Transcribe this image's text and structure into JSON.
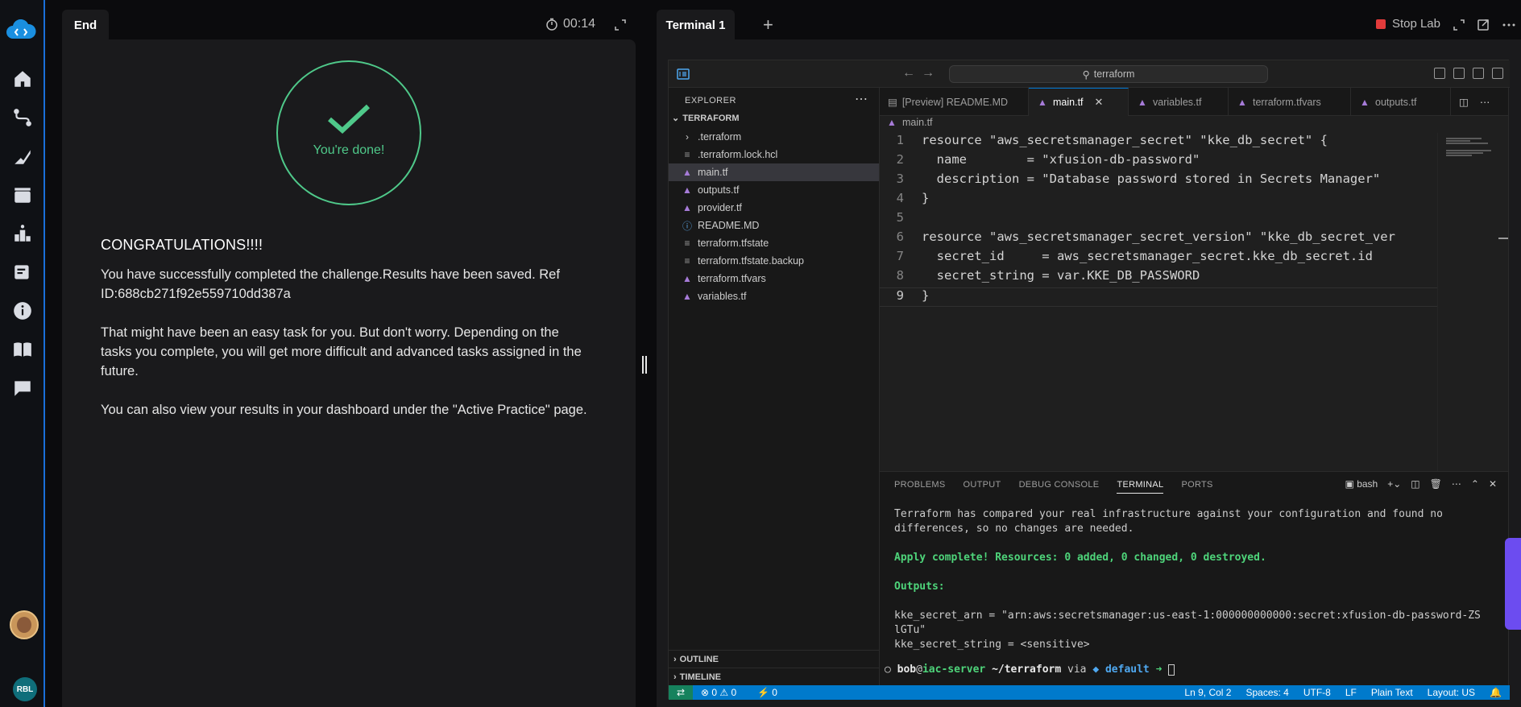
{
  "left_panel": {
    "tab_label": "End",
    "timer": "00:14",
    "done_text": "You're done!",
    "heading": "CONGRATULATIONS!!!!",
    "paragraph1": "You have successfully completed the challenge.Results have been saved. Ref ID:688cb271f92e559710dd387a",
    "paragraph2": "That might have been an easy task for you. But don't worry. Depending on the tasks you complete, you will get more difficult and advanced tasks assigned in the future.",
    "paragraph3": "You can also view your results in your dashboard under the \"Active Practice\" page."
  },
  "rail": {
    "org_badge": "RBL",
    "items": [
      "home-icon",
      "routes-icon",
      "skills-icon",
      "video-icon",
      "leaderboard-icon",
      "notes-icon",
      "info-icon",
      "book-icon",
      "chat-icon"
    ]
  },
  "right_panel": {
    "tab_label": "Terminal 1",
    "add_tab": "+",
    "stop_lab": "Stop Lab"
  },
  "vscode": {
    "search": "terraform",
    "explorer_title": "EXPLORER",
    "folder": "TERRAFORM",
    "files": [
      {
        "name": ".terraform",
        "icon": "chevron-right"
      },
      {
        "name": ".terraform.lock.hcl",
        "icon": "lines"
      },
      {
        "name": "main.tf",
        "icon": "terraform",
        "active": true
      },
      {
        "name": "outputs.tf",
        "icon": "terraform"
      },
      {
        "name": "provider.tf",
        "icon": "terraform"
      },
      {
        "name": "README.MD",
        "icon": "info"
      },
      {
        "name": "terraform.tfstate",
        "icon": "lines"
      },
      {
        "name": "terraform.tfstate.backup",
        "icon": "lines"
      },
      {
        "name": "terraform.tfvars",
        "icon": "terraform"
      },
      {
        "name": "variables.tf",
        "icon": "terraform"
      }
    ],
    "outline": "OUTLINE",
    "timeline": "TIMELINE",
    "tabs": [
      "[Preview] README.MD",
      "main.tf",
      "variables.tf",
      "terraform.tfvars",
      "outputs.tf"
    ],
    "breadcrumb": "main.tf",
    "code": [
      "resource \"aws_secretsmanager_secret\" \"kke_db_secret\" {",
      "  name        = \"xfusion-db-password\"",
      "  description = \"Database password stored in Secrets Manager\"",
      "}",
      "",
      "resource \"aws_secretsmanager_secret_version\" \"kke_db_secret_ver",
      "  secret_id     = aws_secretsmanager_secret.kke_db_secret.id",
      "  secret_string = var.KKE_DB_PASSWORD",
      "}"
    ],
    "line_numbers": [
      "1",
      "2",
      "3",
      "4",
      "5",
      "6",
      "7",
      "8",
      "9"
    ],
    "panel_tabs": [
      "PROBLEMS",
      "OUTPUT",
      "DEBUG CONSOLE",
      "TERMINAL",
      "PORTS"
    ],
    "shell": "bash",
    "terminal": {
      "line1": "Terraform has compared your real infrastructure against your configuration and found no",
      "line2": "differences, so no changes are needed.",
      "apply": "Apply complete! Resources: 0 added, 0 changed, 0 destroyed.",
      "outputs": "Outputs:",
      "arn1": "kke_secret_arn = \"arn:aws:secretsmanager:us-east-1:000000000000:secret:xfusion-db-password-ZS",
      "arn2": "lGTu\"",
      "string": "kke_secret_string = <sensitive>",
      "prompt_user": "bob",
      "prompt_at": "@",
      "prompt_host": "iac-server",
      "prompt_path": " ~/terraform",
      "prompt_via": " via ",
      "prompt_env": "◆ default",
      "prompt_arrow": " ➜ "
    },
    "status": {
      "errors": "⊗ 0 ⚠ 0",
      "ports": "⚡ 0",
      "position": "Ln 9, Col 2",
      "spaces": "Spaces: 4",
      "encoding": "UTF-8",
      "eol": "LF",
      "language": "Plain Text",
      "layout": "Layout: US"
    }
  }
}
